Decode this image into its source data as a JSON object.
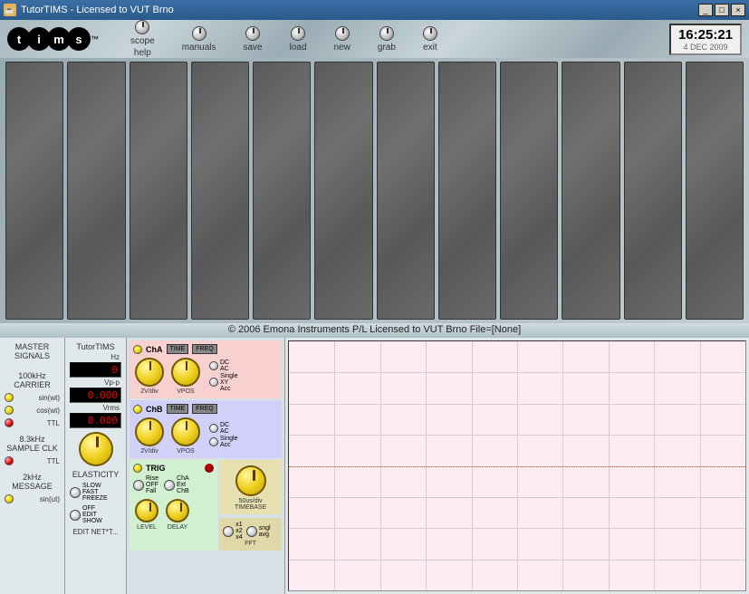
{
  "window": {
    "title": "TutorTIMS - Licensed to VUT Brno",
    "min": "_",
    "max": "□",
    "close": "×"
  },
  "toolbar": {
    "logo_letters": [
      "t",
      "i",
      "m",
      "s"
    ],
    "tm": "™",
    "buttons": {
      "scope": "scope",
      "help": "help",
      "manuals": "manuals",
      "save": "save",
      "load": "load",
      "new": "new",
      "grab": "grab",
      "exit": "exit"
    },
    "clock": {
      "time": "16:25:21",
      "date": "4 DEC 2009"
    }
  },
  "status": "© 2006 Emona Instruments P/L  Licensed to VUT Brno   File=[None]",
  "master": {
    "title": "MASTER SIGNALS",
    "carrier": "100kHz CARRIER",
    "sinwt": "sin(wt)",
    "coswt": "cos(wt)",
    "ttl1": "TTL",
    "sample": "8.3kHz SAMPLE CLK",
    "ttl2": "TTL",
    "message": "2kHz MESSAGE",
    "sinut": "sin(ut)"
  },
  "tutor": {
    "title": "TutorTIMS",
    "hz_label": "Hz",
    "hz_value": "0",
    "vpp_label": "Vp-p",
    "vpp_value": "0.000",
    "vrms_label": "Vrms",
    "vrms_value": "0.000",
    "elasticity": "ELASTICITY",
    "slow": "SLOW",
    "fast": "FAST",
    "freeze": "FREEZE",
    "off": "OFF",
    "edit": "EDIT",
    "show": "SHOW",
    "editnet": "EDIT NET*T..."
  },
  "scope_panel": {
    "cha": {
      "name": "ChA",
      "time": "TIME",
      "freq": "FREQ",
      "scale": "2V/div",
      "vpos": "VPOS",
      "dc": "DC",
      "ac": "AC",
      "single": "Single",
      "xy": "XY",
      "acc": "Acc"
    },
    "chb": {
      "name": "ChB",
      "time": "TIME",
      "freq": "FREQ",
      "scale": "2V/div",
      "vpos": "VPOS",
      "dc": "DC",
      "ac": "AC",
      "single": "Single",
      "acc": "Acc"
    },
    "trig": {
      "name": "TRIG",
      "rise": "Rise",
      "off": "OFF",
      "fall": "Fall",
      "cha": "ChA",
      "ext": "Ext",
      "chb": "ChB",
      "level": "LEVEL",
      "delay": "DELAY"
    },
    "timebase": {
      "value": "50us/div",
      "label": "TIMEBASE"
    },
    "fft": {
      "x1": "x1",
      "x2": "x2",
      "x4": "x4",
      "sngl": "sngl",
      "avg": "avg",
      "label": "FFT"
    }
  }
}
